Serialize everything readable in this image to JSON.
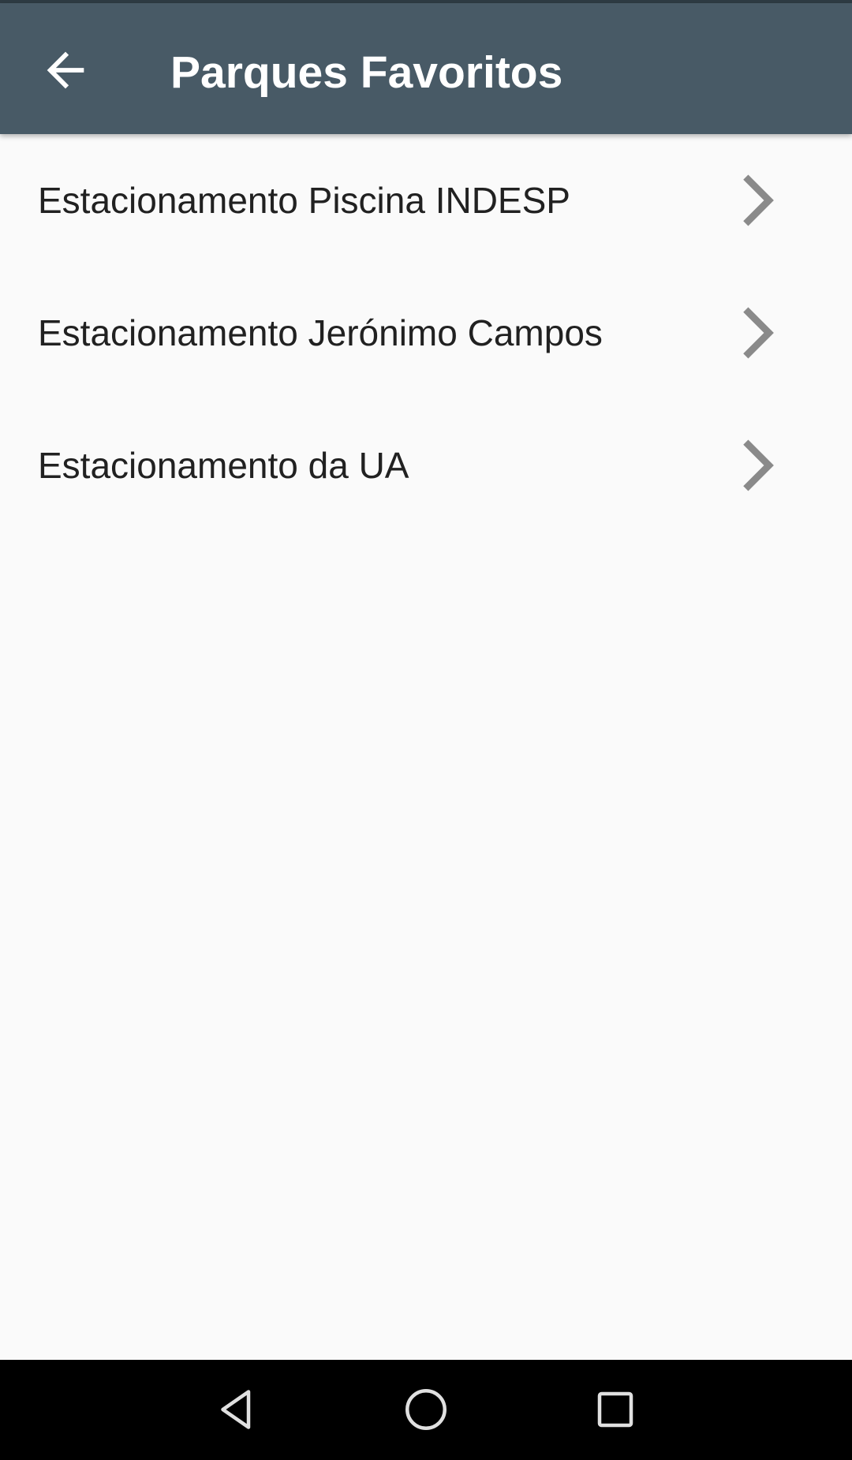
{
  "app_bar": {
    "title": "Parques Favoritos",
    "back_icon": "arrow-left-icon",
    "background": "#485A66",
    "text_color": "#FFFFFF"
  },
  "favorites": {
    "items": [
      {
        "label": "Estacionamento Piscina INDESP",
        "icon": "chevron-right-icon"
      },
      {
        "label": "Estacionamento Jerónimo Campos",
        "icon": "chevron-right-icon"
      },
      {
        "label": "Estacionamento da UA",
        "icon": "chevron-right-icon"
      }
    ],
    "chevron_color": "#8A8A8A"
  },
  "nav_bar": {
    "buttons": [
      {
        "icon": "nav-back-triangle-icon"
      },
      {
        "icon": "nav-home-circle-icon"
      },
      {
        "icon": "nav-recents-square-icon"
      }
    ],
    "background": "#000000",
    "icon_color": "#E0E0E0"
  }
}
